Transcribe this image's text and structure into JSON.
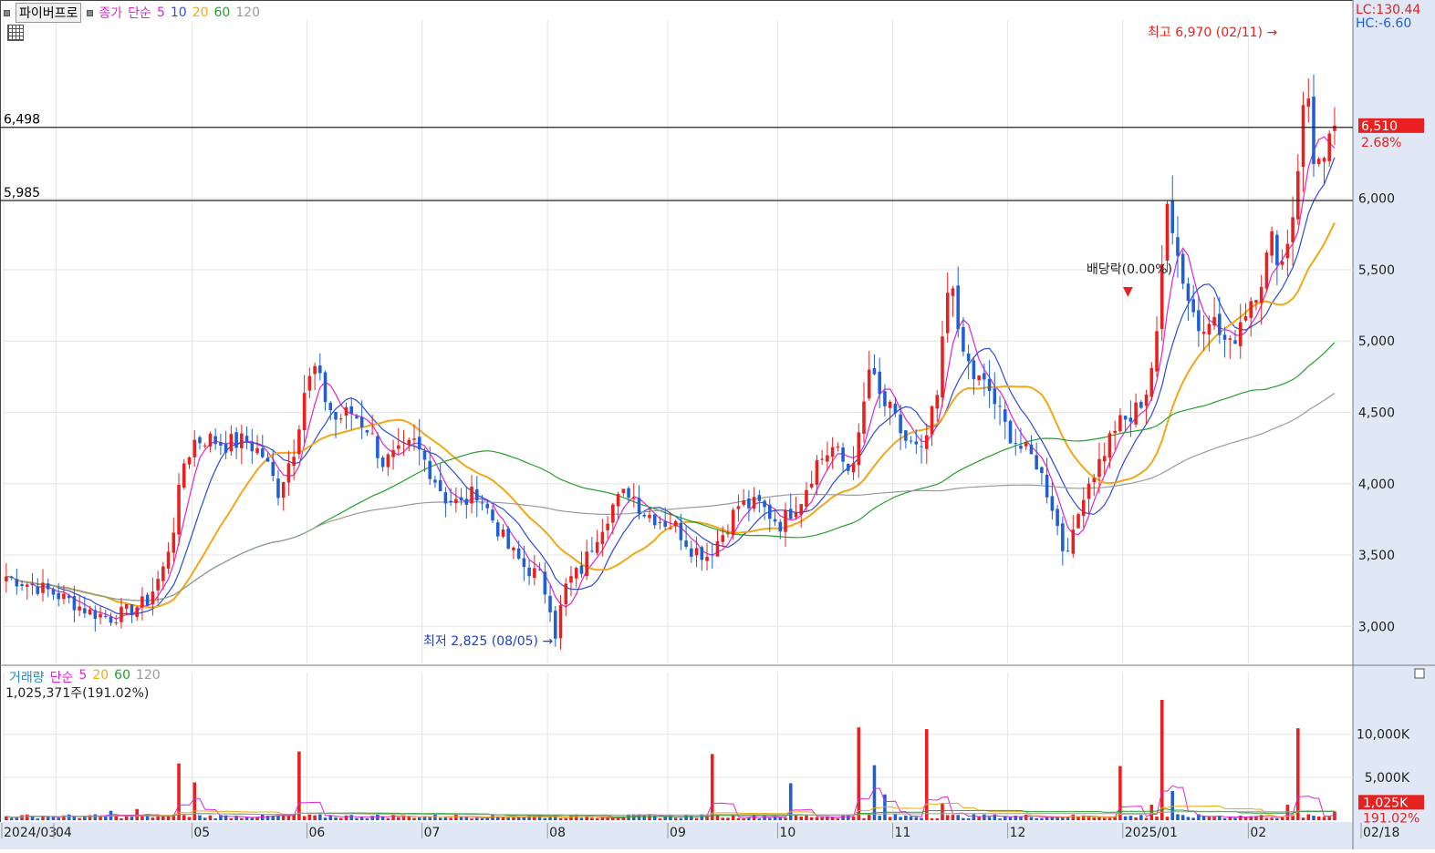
{
  "toolbar": {
    "title_button": "파이버프로",
    "price_legend": {
      "type": "종가",
      "method": "단순",
      "periods": [
        "5",
        "10",
        "20",
        "60",
        "120"
      ]
    },
    "volume_legend": {
      "name": "거래량",
      "method": "단순",
      "periods": [
        "5",
        "20",
        "60",
        "120"
      ]
    },
    "volume_info": "1,025,371주(191.02%)"
  },
  "colors": {
    "up": "#e8201f",
    "down": "#1f5fd6",
    "ma5": "#e024d0",
    "ma10": "#2c4bdc",
    "ma20": "#f0a818",
    "ma60": "#24a02c",
    "ma120": "#9a9a9a",
    "axis_bg": "#dfe8f4",
    "current_bg": "#e8201f"
  },
  "indicators": {
    "lc": "LC:130.44",
    "hc": "HC:-6.60"
  },
  "current": {
    "price": "6,510",
    "change": "2.68%",
    "volume": "1,025K",
    "volume_pct": "191.02%"
  },
  "annotations": {
    "high": "최고 6,970 (02/11)",
    "low": "최저 2,825 (08/05)",
    "dividend": "배당락(0.00%)"
  },
  "chart_data": {
    "type": "candlestick",
    "price_axis": {
      "ticks": [
        3000,
        3500,
        4000,
        4500,
        5000,
        5500,
        6000
      ],
      "labels": [
        "3,000",
        "3,500",
        "4,000",
        "4,500",
        "5,000",
        "5,500",
        "6,000"
      ],
      "ylim": [
        2740,
        7250
      ]
    },
    "volume_axis": {
      "ticks": [
        5000,
        10000
      ],
      "labels": [
        "5,000K",
        "10,000K"
      ],
      "unit": "K",
      "ylim": [
        0,
        14000
      ]
    },
    "x_labels": [
      "2024/03",
      "04",
      "05",
      "06",
      "07",
      "08",
      "09",
      "10",
      "11",
      "12",
      "2025/01",
      "02",
      "02/18"
    ],
    "h_lines": [
      {
        "label": "6,498",
        "value": 6498
      },
      {
        "label": "5,985",
        "value": 5985
      }
    ],
    "month_starts": [
      0,
      10,
      36,
      58,
      80,
      104,
      127,
      148,
      170,
      192,
      214,
      238
    ],
    "sessions": 255,
    "anchors": [
      [
        0,
        3350
      ],
      [
        4,
        3300
      ],
      [
        8,
        3250
      ],
      [
        12,
        3180
      ],
      [
        16,
        3100
      ],
      [
        20,
        3060
      ],
      [
        24,
        3120
      ],
      [
        27,
        3180
      ],
      [
        30,
        3400
      ],
      [
        32,
        3700
      ],
      [
        34,
        4150
      ],
      [
        36,
        4300
      ],
      [
        38,
        4320
      ],
      [
        42,
        4280
      ],
      [
        46,
        4300
      ],
      [
        49,
        4200
      ],
      [
        52,
        3950
      ],
      [
        55,
        4250
      ],
      [
        57,
        4650
      ],
      [
        59,
        4800
      ],
      [
        61,
        4600
      ],
      [
        63,
        4450
      ],
      [
        66,
        4500
      ],
      [
        69,
        4400
      ],
      [
        72,
        4150
      ],
      [
        75,
        4200
      ],
      [
        78,
        4280
      ],
      [
        81,
        4100
      ],
      [
        84,
        3900
      ],
      [
        87,
        3850
      ],
      [
        90,
        3950
      ],
      [
        93,
        3750
      ],
      [
        96,
        3550
      ],
      [
        99,
        3420
      ],
      [
        102,
        3350
      ],
      [
        104,
        3150
      ],
      [
        105,
        2950
      ],
      [
        107,
        3300
      ],
      [
        110,
        3400
      ],
      [
        113,
        3650
      ],
      [
        116,
        3850
      ],
      [
        119,
        3950
      ],
      [
        122,
        3800
      ],
      [
        125,
        3750
      ],
      [
        128,
        3700
      ],
      [
        131,
        3550
      ],
      [
        134,
        3500
      ],
      [
        137,
        3650
      ],
      [
        140,
        3850
      ],
      [
        144,
        3850
      ],
      [
        148,
        3720
      ],
      [
        152,
        3900
      ],
      [
        155,
        4150
      ],
      [
        158,
        4250
      ],
      [
        161,
        4100
      ],
      [
        163,
        4300
      ],
      [
        165,
        4800
      ],
      [
        167,
        4600
      ],
      [
        169,
        4500
      ],
      [
        172,
        4300
      ],
      [
        175,
        4200
      ],
      [
        178,
        4600
      ],
      [
        180,
        5350
      ],
      [
        181,
        5450
      ],
      [
        182,
        5000
      ],
      [
        185,
        4750
      ],
      [
        188,
        4650
      ],
      [
        191,
        4400
      ],
      [
        194,
        4250
      ],
      [
        197,
        4150
      ],
      [
        200,
        3850
      ],
      [
        202,
        3550
      ],
      [
        204,
        3620
      ],
      [
        206,
        3950
      ],
      [
        209,
        4150
      ],
      [
        212,
        4400
      ],
      [
        215,
        4450
      ],
      [
        218,
        4650
      ],
      [
        220,
        5000
      ],
      [
        222,
        6050
      ],
      [
        224,
        5600
      ],
      [
        226,
        5300
      ],
      [
        228,
        5100
      ],
      [
        230,
        5200
      ],
      [
        232,
        5050
      ],
      [
        234,
        4950
      ],
      [
        236,
        5150
      ],
      [
        238,
        5300
      ],
      [
        240,
        5450
      ],
      [
        242,
        5700
      ],
      [
        244,
        5550
      ],
      [
        246,
        5900
      ],
      [
        248,
        6600
      ],
      [
        250,
        6300
      ],
      [
        252,
        6200
      ],
      [
        254,
        6510
      ]
    ],
    "volume_spikes": [
      [
        20,
        1100
      ],
      [
        25,
        1300
      ],
      [
        33,
        6600
      ],
      [
        36,
        4400
      ],
      [
        56,
        8000
      ],
      [
        135,
        7700
      ],
      [
        150,
        4300
      ],
      [
        163,
        10800
      ],
      [
        166,
        6400
      ],
      [
        168,
        3000
      ],
      [
        176,
        10600
      ],
      [
        179,
        2000
      ],
      [
        213,
        6300
      ],
      [
        219,
        1800
      ],
      [
        221,
        14000
      ],
      [
        223,
        3400
      ],
      [
        245,
        1800
      ],
      [
        247,
        10700
      ],
      [
        254,
        1025
      ]
    ],
    "moving_average_periods": [
      5,
      10,
      20,
      60,
      120
    ]
  }
}
